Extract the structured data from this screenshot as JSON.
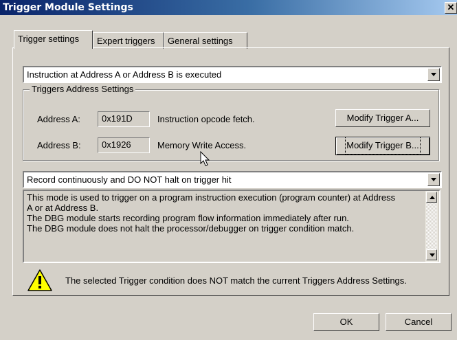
{
  "window": {
    "title": "Trigger Module Settings",
    "close_glyph": "✕"
  },
  "tabs": [
    {
      "label": "Trigger settings",
      "active": true
    },
    {
      "label": "Expert triggers",
      "active": false
    },
    {
      "label": "General settings",
      "active": false
    }
  ],
  "trigger_condition": {
    "value": "Instruction at Address A or Address B is executed"
  },
  "address_group": {
    "title": "Triggers Address Settings",
    "address_a": {
      "label": "Address A:",
      "value": "0x191D",
      "description": "Instruction opcode fetch.",
      "button": "Modify Trigger A..."
    },
    "address_b": {
      "label": "Address B:",
      "value": "0x1926",
      "description": "Memory Write Access.",
      "button": "Modify Trigger B..."
    }
  },
  "record_mode": {
    "value": "Record continuously and DO NOT halt on trigger hit"
  },
  "description": {
    "lines": [
      "This mode is used to trigger on a program instruction execution (program counter) at Address",
      "A or at Address B.",
      "The DBG module starts recording program flow information immediately after run.",
      "The DBG module does not halt the processor/debugger on trigger condition match."
    ]
  },
  "warning": {
    "icon": "warning-icon",
    "text": "The selected Trigger condition does NOT match the current Triggers Address Settings."
  },
  "buttons": {
    "ok": "OK",
    "cancel": "Cancel"
  },
  "colors": {
    "title_bar": "#0a246a",
    "face": "#d4d0c8",
    "warning_fill": "#ffff00"
  }
}
